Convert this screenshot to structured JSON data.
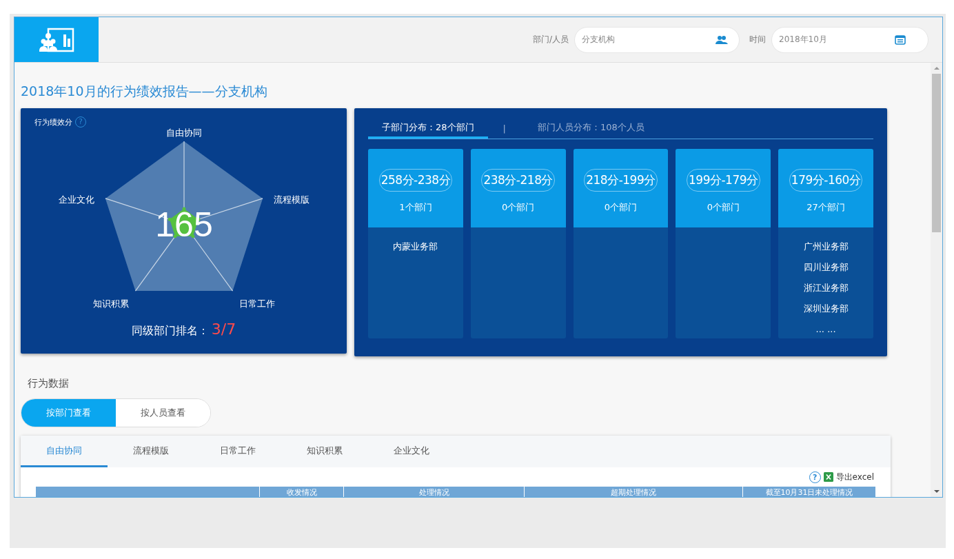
{
  "header": {
    "filters": [
      {
        "label": "部门/人员",
        "value": "分支机构",
        "kind": "people"
      },
      {
        "label": "时间",
        "value": "2018年10月",
        "kind": "calendar"
      }
    ]
  },
  "report_title": "2018年10月的行为绩效报告——分支机构",
  "score_card": {
    "title": "行为绩效分",
    "help": "?",
    "score": "165",
    "axes": [
      "自由协同",
      "流程模版",
      "日常工作",
      "知识积累",
      "企业文化"
    ],
    "rank_label": "同级部门排名：",
    "rank": "3/7"
  },
  "distribution": {
    "tabs": [
      {
        "label": "子部门分布：28个部门",
        "selected": true
      },
      {
        "label": "部门人员分布：108个人员",
        "selected": false
      }
    ],
    "separator": "|",
    "buckets": [
      {
        "range": "258分-238分",
        "count": "1个部门",
        "departments": [
          "内蒙业务部"
        ]
      },
      {
        "range": "238分-218分",
        "count": "0个部门"
      },
      {
        "range": "218分-199分",
        "count": "0个部门"
      },
      {
        "range": "199分-179分",
        "count": "0个部门"
      },
      {
        "range": "179分-160分",
        "count": "27个部门",
        "departments": [
          "广州业务部",
          "四川业务部",
          "浙江业务部",
          "深圳业务部",
          "... ..."
        ]
      }
    ]
  },
  "behavior": {
    "title": "行为数据",
    "views": [
      {
        "label": "按部门查看",
        "selected": true
      },
      {
        "label": "按人员查看",
        "selected": false
      }
    ],
    "tabs": [
      {
        "label": "自由协同",
        "selected": true
      },
      {
        "label": "流程模版",
        "selected": false
      },
      {
        "label": "日常工作",
        "selected": false
      },
      {
        "label": "知识积累",
        "selected": false
      },
      {
        "label": "企业文化",
        "selected": false
      }
    ],
    "help": "?",
    "export": "导出excel",
    "table": {
      "columns": [
        "收发情况",
        "处理情况",
        "超期处理情况",
        "截至10月31日未处理情况"
      ]
    }
  }
}
